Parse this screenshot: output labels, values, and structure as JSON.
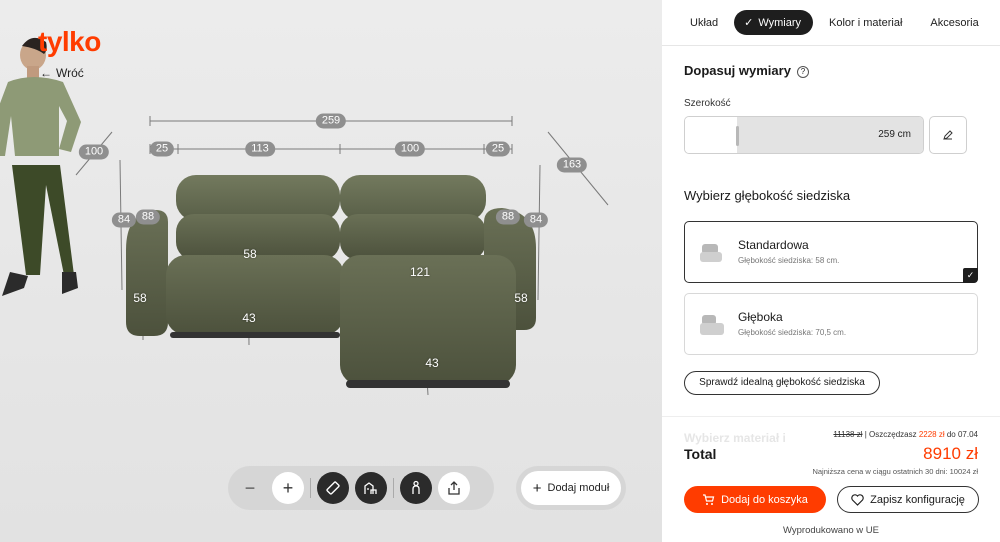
{
  "brand": {
    "logo": "tylko",
    "accent": "#ff3c00"
  },
  "nav": {
    "back_label": "Wróć",
    "back_arrow": "←"
  },
  "dimensions": {
    "total_width": "259",
    "module_widths": [
      "25",
      "113",
      "100",
      "25"
    ],
    "left_depth": "100",
    "right_depth": "163",
    "left_heights": [
      "84",
      "88"
    ],
    "right_heights": [
      "88",
      "84"
    ],
    "seat_labels": {
      "left_back_depth": "58",
      "left_arm_height": "58",
      "left_seat_height": "43",
      "chaise_length": "121",
      "right_arm_height": "58",
      "chaise_seat_height": "43"
    }
  },
  "toolbar": {
    "zoom_out": "−",
    "zoom_in": "+",
    "icons": [
      "ruler-icon",
      "room-icon",
      "person-icon",
      "share-icon"
    ],
    "add_module_icon": "+",
    "add_module_label": "Dodaj moduł"
  },
  "tabs": [
    {
      "label": "Układ",
      "active": false
    },
    {
      "label": "Wymiary",
      "active": true
    },
    {
      "label": "Kolor i materiał",
      "active": false
    },
    {
      "label": "Akcesoria",
      "active": false
    }
  ],
  "fit": {
    "title": "Dopasuj wymiary",
    "help": "?",
    "width_label": "Szerokość",
    "width_value": "259 cm"
  },
  "depth": {
    "title": "Wybierz głębokość siedziska",
    "options": [
      {
        "name": "Standardowa",
        "desc": "Głębokość siedziska: 58 cm.",
        "selected": true
      },
      {
        "name": "Głęboka",
        "desc": "Głębokość siedziska: 70,5 cm.",
        "selected": false
      }
    ],
    "check_link": "Sprawdź idealną głębokość siedziska"
  },
  "summary": {
    "faded_heading": "Wybierz materiał i",
    "old_price": "11138 zł",
    "save_text": "| Oszczędzasz",
    "save_amount": "2228 zł",
    "save_until": "do 07.04",
    "total_label": "Total",
    "total_price": "8910 zł",
    "lowest_note": "Najniższa cena w ciągu ostatnich 30 dni: 10024 zł",
    "cart_label": "Dodaj do koszyka",
    "save_config_label": "Zapisz konfigurację",
    "made_in": "Wyprodukowano w UE"
  },
  "colors": {
    "fabric": "#5b6148",
    "tab_active": "#1e1e1e",
    "dim_pill": "#8f8f8f"
  }
}
